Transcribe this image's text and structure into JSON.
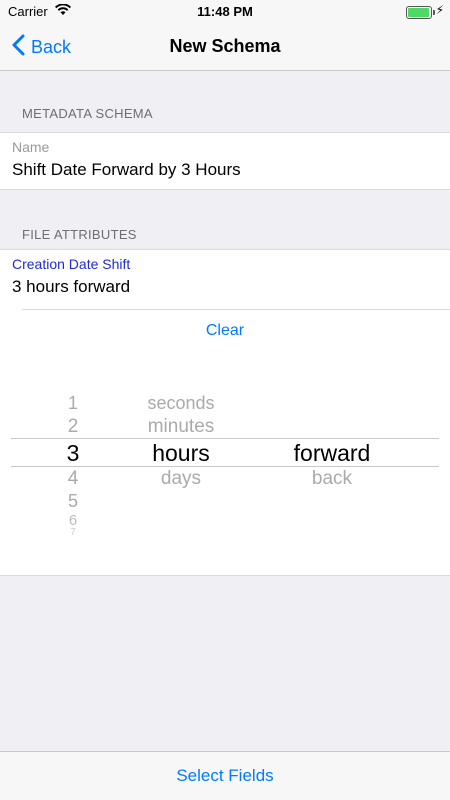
{
  "status_bar": {
    "carrier": "Carrier",
    "time": "11:48 PM",
    "wifi_icon": "wifi-icon",
    "battery_icon": "battery-icon"
  },
  "nav": {
    "back_label": "Back",
    "title": "New Schema"
  },
  "metadata_section": {
    "header": "METADATA SCHEMA",
    "name_label": "Name",
    "name_value": "Shift Date Forward by 3 Hours"
  },
  "file_attributes_section": {
    "header": "FILE ATTRIBUTES",
    "field_label": "Creation Date Shift",
    "field_value": "3 hours forward",
    "clear_label": "Clear"
  },
  "picker": {
    "numbers": [
      "1",
      "2",
      "3",
      "4",
      "5",
      "6",
      "7"
    ],
    "units": [
      "seconds",
      "minutes",
      "hours",
      "days"
    ],
    "directions": [
      "forward",
      "back"
    ],
    "selected_number": "3",
    "selected_unit": "hours",
    "selected_direction": "forward"
  },
  "bottom": {
    "select_fields_label": "Select Fields"
  },
  "colors": {
    "accent": "#007aff",
    "active_label": "#1f2ad6",
    "background": "#efeff4"
  }
}
